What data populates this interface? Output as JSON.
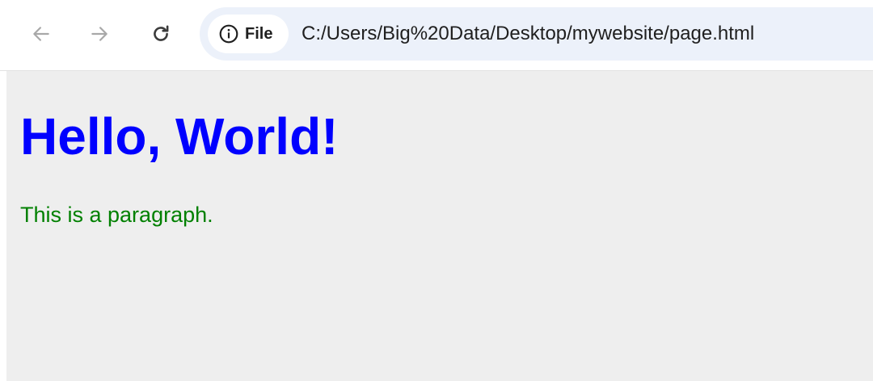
{
  "toolbar": {
    "back_icon": "arrow-left-icon",
    "forward_icon": "arrow-right-icon",
    "reload_icon": "reload-icon",
    "site_info_icon": "info-circle-icon",
    "site_chip_label": "File",
    "url": "C:/Users/Big%20Data/Desktop/mywebsite/page.html",
    "nav_disabled_color": "#a8a8a8",
    "nav_enabled_color": "#3c3c3c",
    "omnibox_bg": "#ecf1fa"
  },
  "page": {
    "heading": "Hello, World!",
    "paragraph": "This is a paragraph.",
    "background": "#eeeeee",
    "heading_color": "#0000ff",
    "paragraph_color": "#008000"
  }
}
